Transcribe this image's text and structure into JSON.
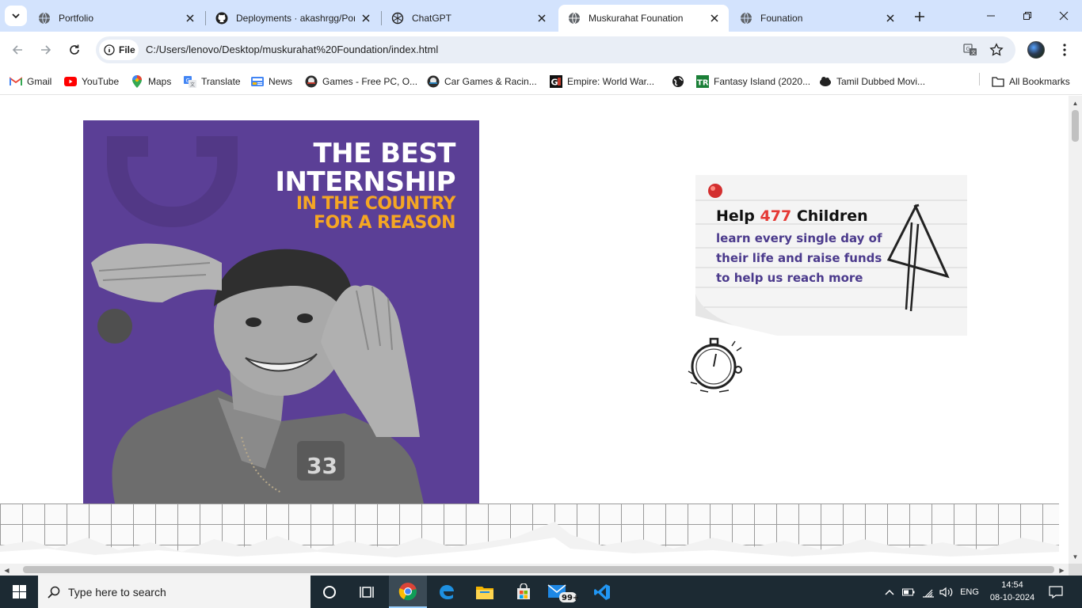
{
  "browser": {
    "tabs": [
      {
        "title": "Portfolio",
        "icon": "globe-icon"
      },
      {
        "title": "Deployments · akashrgg/Por",
        "icon": "github-icon"
      },
      {
        "title": "ChatGPT",
        "icon": "chatgpt-icon"
      },
      {
        "title": "Muskurahat Founation",
        "icon": "globe-icon",
        "active": true
      },
      {
        "title": "Founation",
        "icon": "globe-icon"
      }
    ],
    "omnibox": {
      "chip_label": "File",
      "url": "C:/Users/lenovo/Desktop/muskurahat%20Foundation/index.html"
    },
    "bookmarks": [
      {
        "label": "Gmail",
        "icon": "gmail-icon"
      },
      {
        "label": "YouTube",
        "icon": "youtube-icon"
      },
      {
        "label": "Maps",
        "icon": "maps-icon"
      },
      {
        "label": "Translate",
        "icon": "translate-icon"
      },
      {
        "label": "News",
        "icon": "news-icon"
      },
      {
        "label": "Games - Free PC, O...",
        "icon": "games-icon"
      },
      {
        "label": "Car Games & Racin...",
        "icon": "car-games-icon"
      },
      {
        "label": "Empire: World War...",
        "icon": "empire-icon"
      },
      {
        "label": "",
        "icon": "globe-icon"
      },
      {
        "label": "Fantasy Island (2020...",
        "icon": "fantasy-icon"
      },
      {
        "label": "Tamil Dubbed Movi...",
        "icon": "movie-icon"
      }
    ],
    "all_bookmarks_label": "All Bookmarks"
  },
  "page": {
    "poster": {
      "line1": "THE BEST",
      "line2": "INTERNSHIP",
      "line3": "IN THE COUNTRY",
      "line4": "FOR A REASON",
      "jersey_text": "33",
      "colors": {
        "background": "#5b3f96",
        "accent": "#f5a623"
      }
    },
    "help_card": {
      "prefix": "Help",
      "count": "477",
      "suffix": "Children",
      "line2": "learn every single day of",
      "line3": "their life and raise funds",
      "line4": "to help us reach more",
      "colors": {
        "count": "#e53935",
        "subtext": "#4b3a8c"
      }
    }
  },
  "taskbar": {
    "search_placeholder": "Type here to search",
    "mail_badge": "99+",
    "language": "ENG",
    "time": "14:54",
    "date": "08-10-2024"
  }
}
